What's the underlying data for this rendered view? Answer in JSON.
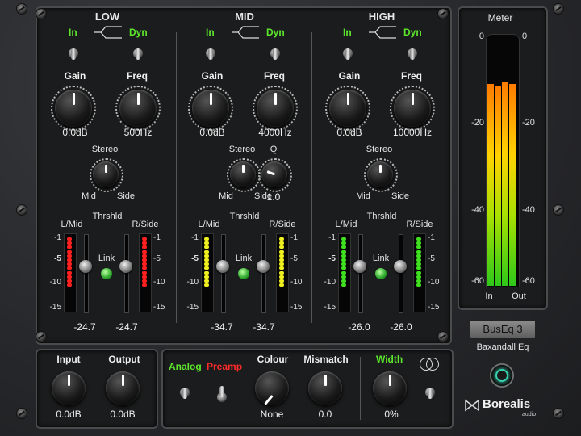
{
  "bands": [
    {
      "title": "LOW",
      "in_label": "In",
      "dyn_label": "Dyn",
      "gain": {
        "label": "Gain",
        "value": "0.0dB"
      },
      "freq": {
        "label": "Freq",
        "value": "500Hz"
      },
      "stereo": {
        "label": "Stereo",
        "left": "Mid",
        "right": "Side"
      },
      "threshold": {
        "label": "Thrshld",
        "left_label": "L/Mid",
        "right_label": "R/Side",
        "link_label": "Link",
        "left_value": "-24.7",
        "right_value": "-24.7"
      },
      "led_color": "#ff2020"
    },
    {
      "title": "MID",
      "in_label": "In",
      "dyn_label": "Dyn",
      "gain": {
        "label": "Gain",
        "value": "0.0dB"
      },
      "freq": {
        "label": "Freq",
        "value": "4000Hz"
      },
      "stereo": {
        "label": "Stereo",
        "left": "Mid",
        "right": "Side"
      },
      "q": {
        "label": "Q",
        "value": "1.0"
      },
      "threshold": {
        "label": "Thrshld",
        "left_label": "L/Mid",
        "right_label": "R/Side",
        "link_label": "Link",
        "left_value": "-34.7",
        "right_value": "-34.7"
      },
      "led_color": "#f0f020"
    },
    {
      "title": "HIGH",
      "in_label": "In",
      "dyn_label": "Dyn",
      "gain": {
        "label": "Gain",
        "value": "0.0dB"
      },
      "freq": {
        "label": "Freq",
        "value": "10000Hz"
      },
      "stereo": {
        "label": "Stereo",
        "left": "Mid",
        "right": "Side"
      },
      "threshold": {
        "label": "Thrshld",
        "left_label": "L/Mid",
        "right_label": "R/Side",
        "link_label": "Link",
        "left_value": "-26.0",
        "right_value": "-26.0"
      },
      "led_color": "#40e020"
    }
  ],
  "threshold_scale": [
    "-1",
    "-5",
    "-10",
    "-15"
  ],
  "meter": {
    "title": "Meter",
    "scale": [
      "0",
      "-20",
      "-40",
      "-60"
    ],
    "in_label": "In",
    "out_label": "Out",
    "levels": [
      0.84,
      0.83,
      0.85,
      0.84
    ]
  },
  "preset": {
    "name": "BusEq 3",
    "subtitle": "Baxandall Eq"
  },
  "io": {
    "input_label": "Input",
    "input_value": "0.0dB",
    "output_label": "Output",
    "output_value": "0.0dB"
  },
  "bottom": {
    "analog_label": "Analog",
    "preamp_label": "Preamp",
    "colour_label": "Colour",
    "colour_value": "None",
    "mismatch_label": "Mismatch",
    "mismatch_value": "0.0",
    "width_label": "Width",
    "width_value": "0%"
  },
  "brand": {
    "name": "Borealis",
    "sub": "audio"
  },
  "colors": {
    "accent_green": "#5ce62c",
    "accent_red": "#ff2a2a"
  }
}
